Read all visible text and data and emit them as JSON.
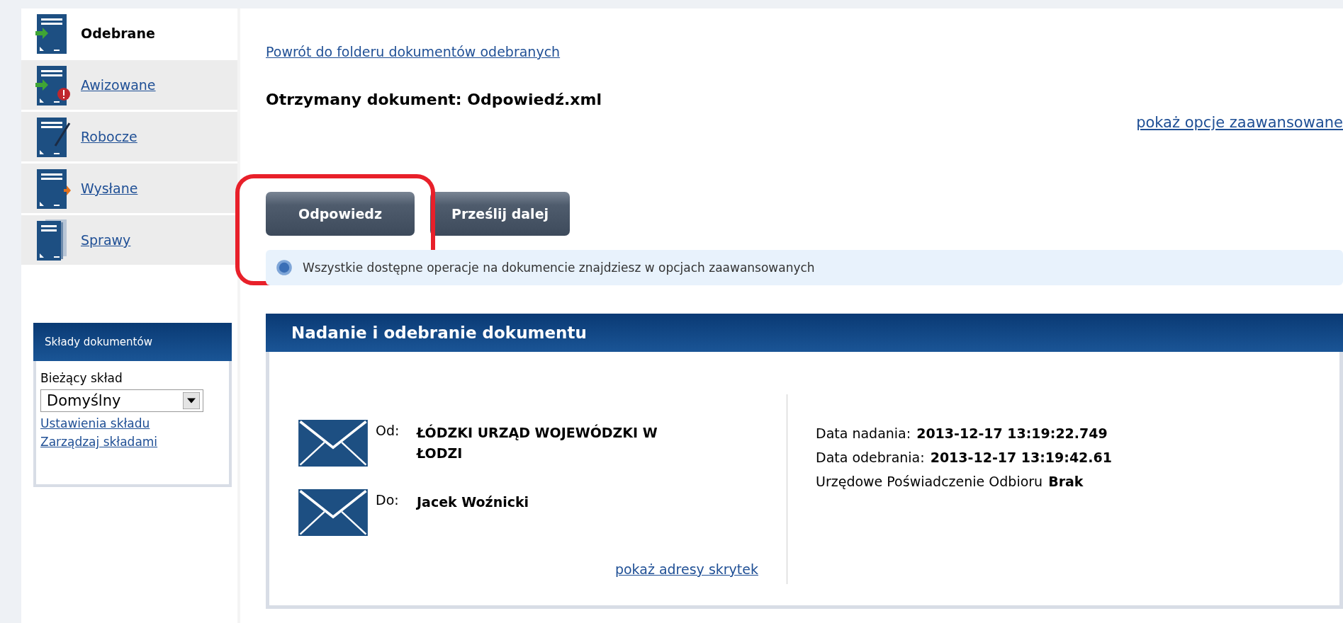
{
  "sidebar": {
    "folders": [
      {
        "label": "Odebrane",
        "selected": true,
        "kind": "received"
      },
      {
        "label": "Awizowane",
        "selected": false,
        "kind": "notified"
      },
      {
        "label": "Robocze",
        "selected": false,
        "kind": "draft"
      },
      {
        "label": "Wysłane",
        "selected": false,
        "kind": "sent"
      },
      {
        "label": "Sprawy",
        "selected": false,
        "kind": "cases"
      }
    ],
    "stores": {
      "title": "Składy dokumentów",
      "current_label": "Bieżący skład",
      "current_value": "Domyślny",
      "links": [
        "Ustawienia składu",
        "Zarządzaj składami"
      ]
    }
  },
  "main": {
    "back_link": "Powrót do folderu dokumentów odebranych",
    "title": "Otrzymany dokument: Odpowiedź.xml",
    "advanced_link": "pokaż opcje zaawansowane",
    "buttons": [
      "Odpowiedz",
      "Prześlij dalej"
    ],
    "info": "Wszystkie dostępne operacje na dokumencie znajdziesz w opcjach zaawansowanych",
    "panel": {
      "title": "Nadanie i odebranie dokumentu",
      "parties": [
        {
          "label": "Od:",
          "value": "ŁÓDZKI URZĄD WOJEWÓDZKI W ŁODZI"
        },
        {
          "label": "Do:",
          "value": "Jacek Woźnicki"
        }
      ],
      "addresses_link": "pokaż adresy skrytek",
      "details": [
        {
          "label": "Data nadania:",
          "value": "2013-12-17 13:19:22.749"
        },
        {
          "label": "Data odebrania:",
          "value": "2013-12-17 13:19:42.61"
        },
        {
          "label": "Urzędowe Poświadczenie Odbioru",
          "value": "Brak"
        }
      ]
    }
  }
}
